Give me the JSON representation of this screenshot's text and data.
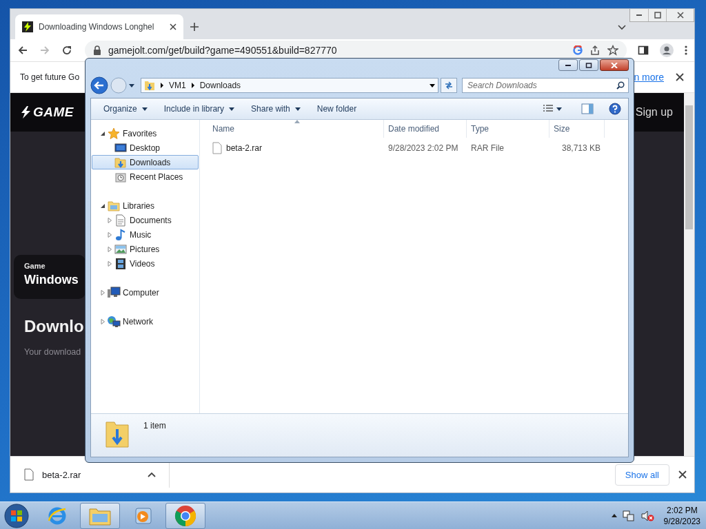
{
  "browser": {
    "tabs": [
      {
        "title": "Downloading Windows Longhel",
        "selected": true
      }
    ],
    "url": "gamejolt.com/get/build?game=490551&build=827770",
    "info_bar": {
      "message": "To get future Go",
      "link": "n more"
    },
    "page": {
      "logo": "GAME",
      "sign_up": "Sign up",
      "card_label": "Game",
      "card_title": "Windows",
      "heading": "Downlo",
      "subtext": "Your download"
    },
    "download_bar": {
      "file": "beta-2.rar",
      "show_all": "Show all"
    }
  },
  "explorer": {
    "breadcrumb": [
      "VM1",
      "Downloads"
    ],
    "search": {
      "placeholder": "Search Downloads"
    },
    "toolbar": [
      {
        "label": "Organize",
        "dropdown": true
      },
      {
        "label": "Include in library",
        "dropdown": true
      },
      {
        "label": "Share with",
        "dropdown": true
      },
      {
        "label": "New folder",
        "dropdown": false
      }
    ],
    "nav": [
      {
        "label": "Favorites",
        "kind": "favorites",
        "expanded": true,
        "selected": false,
        "children": [
          {
            "label": "Desktop",
            "kind": "desktop",
            "selected": false
          },
          {
            "label": "Downloads",
            "kind": "downloads",
            "selected": true
          },
          {
            "label": "Recent Places",
            "kind": "recent",
            "selected": false
          }
        ]
      },
      {
        "label": "Libraries",
        "kind": "libraries",
        "expanded": true,
        "selected": false,
        "children": [
          {
            "label": "Documents",
            "kind": "documents",
            "expanded": false,
            "selected": false
          },
          {
            "label": "Music",
            "kind": "music",
            "expanded": false,
            "selected": false
          },
          {
            "label": "Pictures",
            "kind": "pictures",
            "expanded": false,
            "selected": false
          },
          {
            "label": "Videos",
            "kind": "videos",
            "expanded": false,
            "selected": false
          }
        ]
      },
      {
        "label": "Computer",
        "kind": "computer",
        "expanded": false,
        "selected": false
      },
      {
        "label": "Network",
        "kind": "network",
        "expanded": false,
        "selected": false
      }
    ],
    "columns": [
      "Name",
      "Date modified",
      "Type",
      "Size"
    ],
    "rows": [
      {
        "name": "beta-2.rar",
        "date": "9/28/2023 2:02 PM",
        "type": "RAR File",
        "size": "38,713 KB"
      }
    ],
    "status": "1 item"
  },
  "taskbar": {
    "apps": [
      {
        "kind": "ie",
        "active": false
      },
      {
        "kind": "explorer",
        "active": true
      },
      {
        "kind": "media",
        "active": false
      },
      {
        "kind": "chrome",
        "active": true
      }
    ],
    "time": "2:02 PM",
    "date": "9/28/2023"
  }
}
